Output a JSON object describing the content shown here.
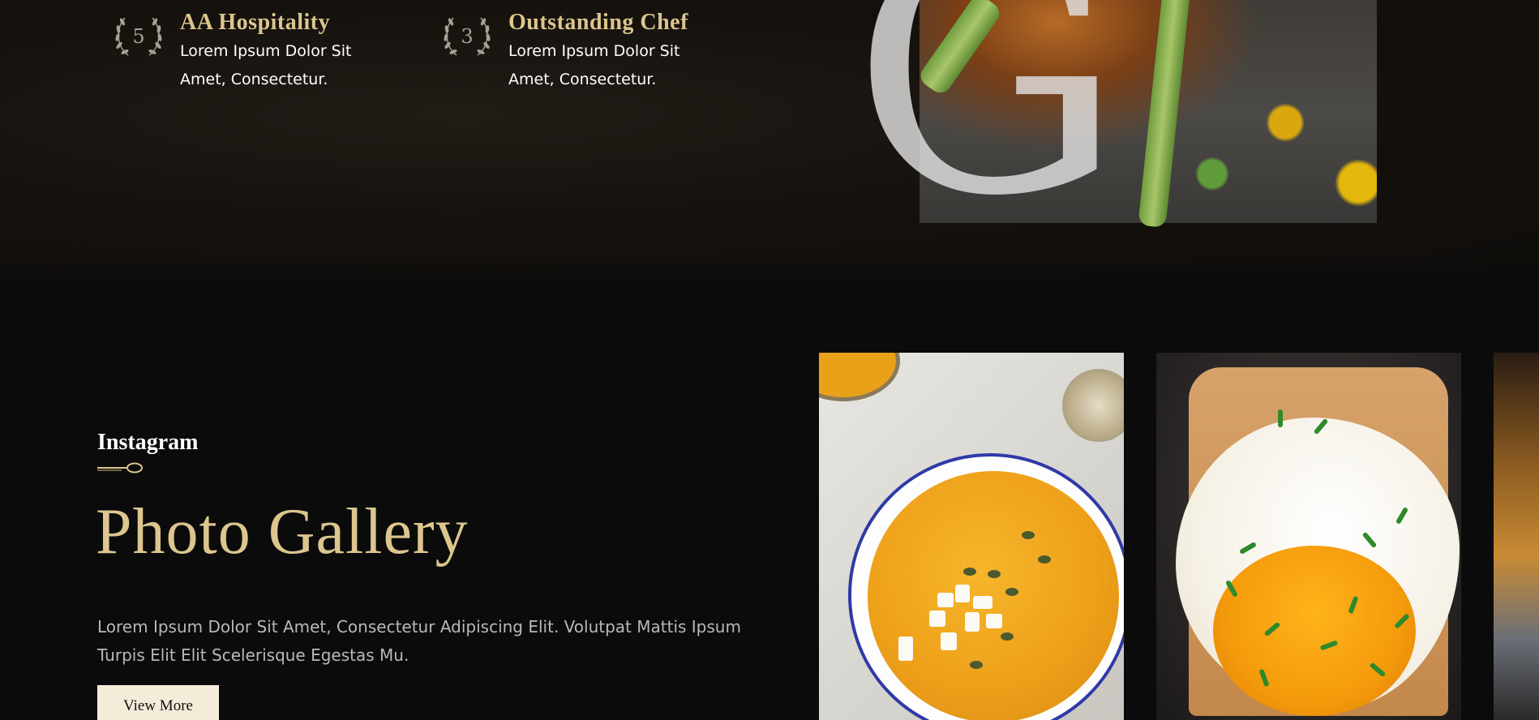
{
  "awards": [
    {
      "number": "5",
      "title": "AA Hospitality",
      "desc_line1": "Lorem Ipsum Dolor Sit",
      "desc_line2": "Amet, Consectetur."
    },
    {
      "number": "3",
      "title": "Outstanding Chef",
      "desc_line1": "Lorem Ipsum Dolor Sit",
      "desc_line2": "Amet, Consectetur."
    }
  ],
  "hero": {
    "decorative_letter": "G"
  },
  "gallery": {
    "label": "Instagram",
    "title": "Photo Gallery",
    "description": "Lorem Ipsum Dolor Sit Amet, Consectetur Adipiscing Elit. Volutpat Mattis Ipsum Turpis Elit Elit Scelerisque Egestas Mu.",
    "button_label": "View More"
  },
  "colors": {
    "accent_gold": "#dcc68e",
    "background": "#0b0b0b",
    "button_bg": "#f3ecd9"
  },
  "icons": {
    "laurel": "laurel-wreath-icon",
    "divider": "spoon-divider-icon"
  }
}
